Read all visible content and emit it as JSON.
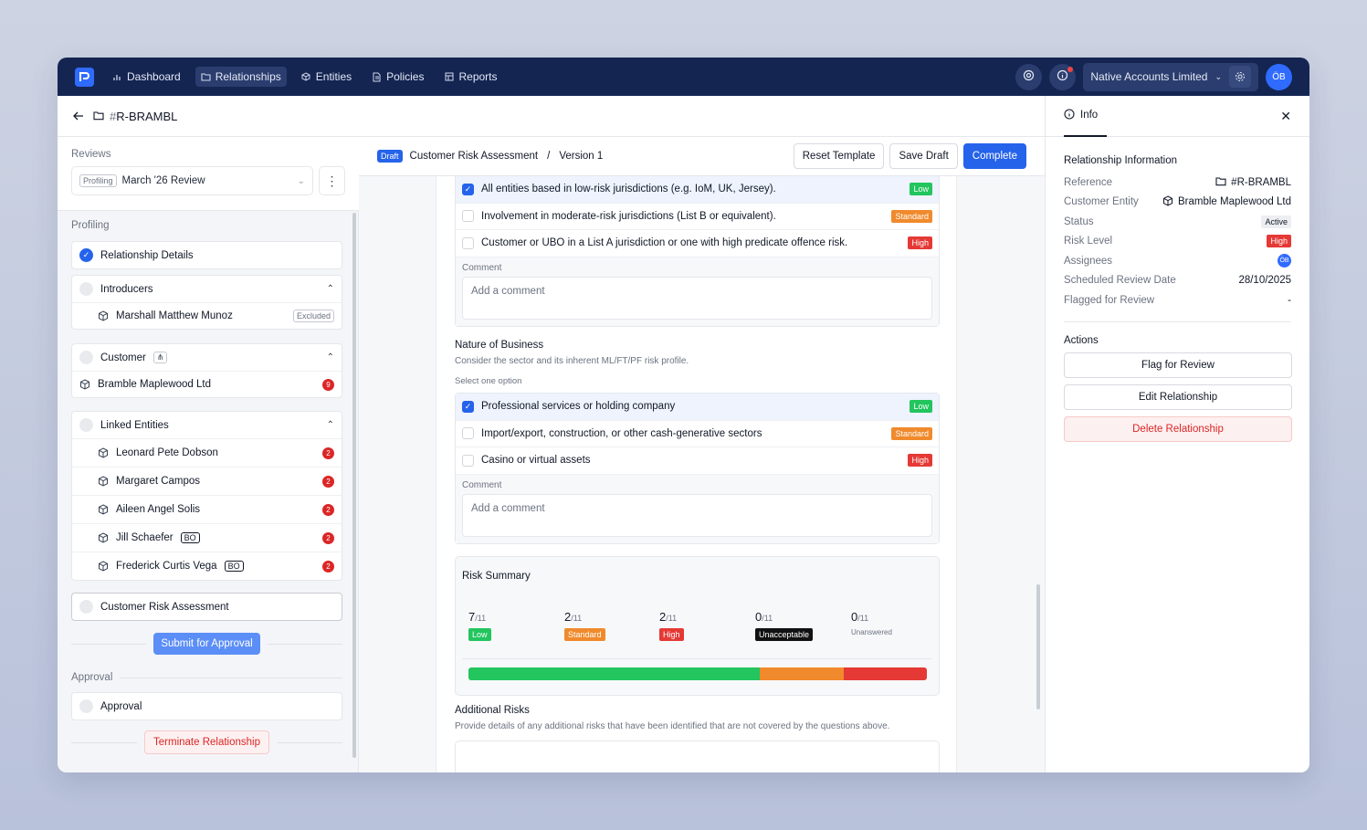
{
  "nav": {
    "items": [
      {
        "label": "Dashboard",
        "icon": "bar-chart-icon",
        "active": false
      },
      {
        "label": "Relationships",
        "icon": "folder-icon",
        "active": true
      },
      {
        "label": "Entities",
        "icon": "cube-icon",
        "active": false
      },
      {
        "label": "Policies",
        "icon": "document-icon",
        "active": false
      },
      {
        "label": "Reports",
        "icon": "table-icon",
        "active": false
      }
    ],
    "org_name": "Native Accounts Limited",
    "avatar_initials": "ÖB"
  },
  "header": {
    "hash": "#",
    "reference": "R-BRAMBL"
  },
  "left": {
    "reviews_label": "Reviews",
    "review_tag": "Profiling",
    "review_name": "March '26 Review",
    "profiling_label": "Profiling",
    "relationship_details": "Relationship Details",
    "introducers": "Introducers",
    "introducer_person": "Marshall Matthew Munoz",
    "excluded_label": "Excluded",
    "customer": "Customer",
    "customer_entity": "Bramble Maplewood Ltd",
    "customer_count": "9",
    "linked_entities": "Linked Entities",
    "linked": [
      {
        "name": "Leonard Pete Dobson",
        "bo": "",
        "count": "2"
      },
      {
        "name": "Margaret Campos",
        "bo": "",
        "count": "2"
      },
      {
        "name": "Aileen Angel Solis",
        "bo": "",
        "count": "2"
      },
      {
        "name": "Jill Schaefer",
        "bo": "BO",
        "count": "2"
      },
      {
        "name": "Frederick Curtis Vega",
        "bo": "BO",
        "count": "2"
      }
    ],
    "cra": "Customer Risk Assessment",
    "submit_label": "Submit for Approval",
    "approval_section": "Approval",
    "approval_item": "Approval",
    "terminate_label": "Terminate Relationship"
  },
  "center": {
    "draft_label": "Draft",
    "doc_title": "Customer Risk Assessment",
    "separator": "/",
    "version": "Version 1",
    "reset_label": "Reset Template",
    "save_label": "Save Draft",
    "complete_label": "Complete",
    "q1_options": [
      {
        "text": "All entities based in low-risk jurisdictions (e.g. IoM, UK, Jersey).",
        "tag": "Low",
        "checked": true
      },
      {
        "text": "Involvement in moderate-risk jurisdictions (List B or equivalent).",
        "tag": "Standard",
        "checked": false
      },
      {
        "text": "Customer or UBO in a List A jurisdiction or one with high predicate offence risk.",
        "tag": "High",
        "checked": false
      }
    ],
    "comment_label": "Comment",
    "comment_placeholder": "Add a comment",
    "q2_title": "Nature of Business",
    "q2_desc": "Consider the sector and its inherent ML/FT/PF risk profile.",
    "q2_select": "Select one option",
    "q2_options": [
      {
        "text": "Professional services or holding company",
        "tag": "Low",
        "checked": true
      },
      {
        "text": "Import/export, construction, or other cash-generative sectors",
        "tag": "Standard",
        "checked": false
      },
      {
        "text": "Casino or virtual assets",
        "tag": "High",
        "checked": false
      }
    ],
    "summary_title": "Risk Summary",
    "summary": [
      {
        "count": "7",
        "total": "/11",
        "label": "Low"
      },
      {
        "count": "2",
        "total": "/11",
        "label": "Standard"
      },
      {
        "count": "2",
        "total": "/11",
        "label": "High"
      },
      {
        "count": "0",
        "total": "/11",
        "label": "Unacceptable"
      },
      {
        "count": "0",
        "total": "/11",
        "label": "Unanswered"
      }
    ],
    "summary_bar_fractions": {
      "low": 0.636,
      "standard": 0.182,
      "high": 0.182
    },
    "additional_title": "Additional Risks",
    "additional_desc": "Provide details of any additional risks that have been identified that are not covered by the questions above."
  },
  "right": {
    "tab_label": "Info",
    "section_title": "Relationship Information",
    "fields": {
      "reference_label": "Reference",
      "reference_value": "#R-BRAMBL",
      "entity_label": "Customer Entity",
      "entity_value": "Bramble Maplewood Ltd",
      "status_label": "Status",
      "status_value": "Active",
      "risk_label": "Risk Level",
      "risk_value": "High",
      "assignees_label": "Assignees",
      "assignee_initials": "ÖB",
      "review_date_label": "Scheduled Review Date",
      "review_date_value": "28/10/2025",
      "flagged_label": "Flagged for Review",
      "flagged_value": "-"
    },
    "actions_title": "Actions",
    "flag_label": "Flag for Review",
    "edit_label": "Edit Relationship",
    "delete_label": "Delete Relationship"
  },
  "colors": {
    "navy": "#142552",
    "accent": "#2563eb",
    "low": "#22c55e",
    "standard": "#f08a2c",
    "high": "#e53935"
  }
}
